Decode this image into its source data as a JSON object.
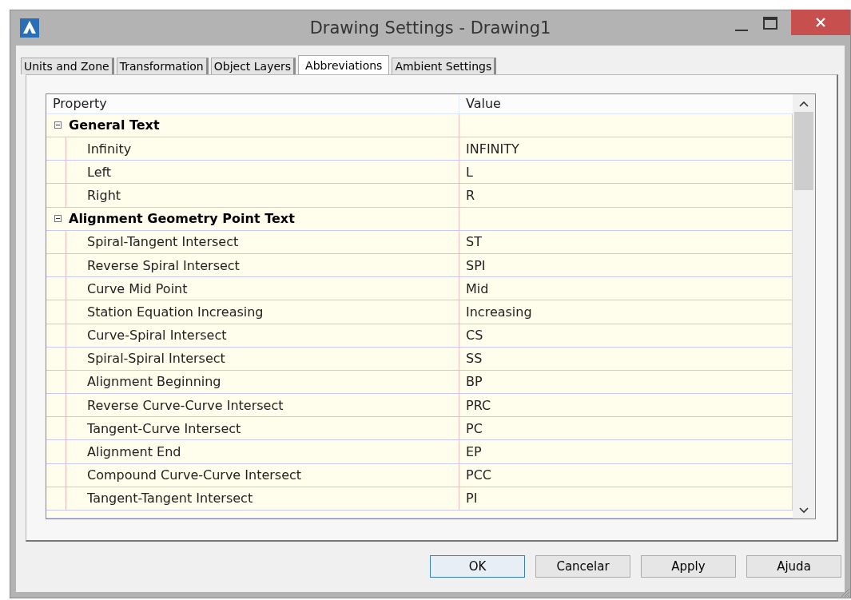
{
  "window": {
    "title": "Drawing Settings - Drawing1"
  },
  "tabs": [
    {
      "label": "Units and Zone",
      "selected": false
    },
    {
      "label": "Transformation",
      "selected": false
    },
    {
      "label": "Object Layers",
      "selected": false
    },
    {
      "label": "Abbreviations",
      "selected": true
    },
    {
      "label": "Ambient Settings",
      "selected": false
    }
  ],
  "grid": {
    "columns": [
      "Property",
      "Value"
    ],
    "groups": [
      {
        "label": "General Text",
        "expanded": true,
        "rows": [
          {
            "property": "Infinity",
            "value": "INFINITY"
          },
          {
            "property": "Left",
            "value": "L"
          },
          {
            "property": "Right",
            "value": "R"
          }
        ]
      },
      {
        "label": "Alignment Geometry Point Text",
        "expanded": true,
        "rows": [
          {
            "property": "Spiral-Tangent Intersect",
            "value": "ST"
          },
          {
            "property": "Reverse Spiral Intersect",
            "value": "SPI"
          },
          {
            "property": "Curve Mid Point",
            "value": "Mid"
          },
          {
            "property": "Station Equation Increasing",
            "value": "Increasing"
          },
          {
            "property": "Curve-Spiral Intersect",
            "value": "CS"
          },
          {
            "property": "Spiral-Spiral Intersect",
            "value": "SS"
          },
          {
            "property": "Alignment Beginning",
            "value": "BP"
          },
          {
            "property": "Reverse Curve-Curve Intersect",
            "value": "PRC"
          },
          {
            "property": "Tangent-Curve Intersect",
            "value": "PC"
          },
          {
            "property": "Alignment End",
            "value": "EP"
          },
          {
            "property": "Compound Curve-Curve Intersect",
            "value": "PCC"
          },
          {
            "property": "Tangent-Tangent Intersect",
            "value": "PI"
          }
        ]
      }
    ]
  },
  "buttons": [
    {
      "label": "OK",
      "default": true
    },
    {
      "label": "Cancelar",
      "default": false
    },
    {
      "label": "Apply",
      "default": false
    },
    {
      "label": "Ajuda",
      "default": false
    }
  ]
}
